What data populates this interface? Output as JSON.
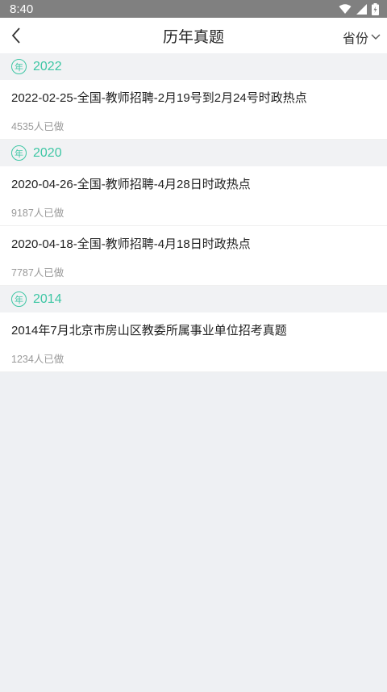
{
  "status": {
    "time": "8:40"
  },
  "header": {
    "title": "历年真题",
    "province_label": "省份"
  },
  "groups": [
    {
      "year_badge": "年",
      "year": "2022",
      "items": [
        {
          "title": "2022-02-25-全国-教师招聘-2月19号到2月24号时政热点",
          "count": "4535人已做"
        }
      ]
    },
    {
      "year_badge": "年",
      "year": "2020",
      "items": [
        {
          "title": "2020-04-26-全国-教师招聘-4月28日时政热点",
          "count": "9187人已做"
        },
        {
          "title": "2020-04-18-全国-教师招聘-4月18日时政热点",
          "count": "7787人已做"
        }
      ]
    },
    {
      "year_badge": "年",
      "year": "2014",
      "items": [
        {
          "title": "2014年7月北京市房山区教委所属事业单位招考真题",
          "count": "1234人已做"
        }
      ]
    }
  ],
  "colors": {
    "accent": "#3dc6a4",
    "statusbar": "#808080",
    "background": "#eef0f3"
  },
  "icons": {
    "back": "chevron-left-icon",
    "dropdown": "chevron-down-icon",
    "wifi": "wifi-icon",
    "signal": "signal-icon",
    "battery": "battery-icon"
  }
}
